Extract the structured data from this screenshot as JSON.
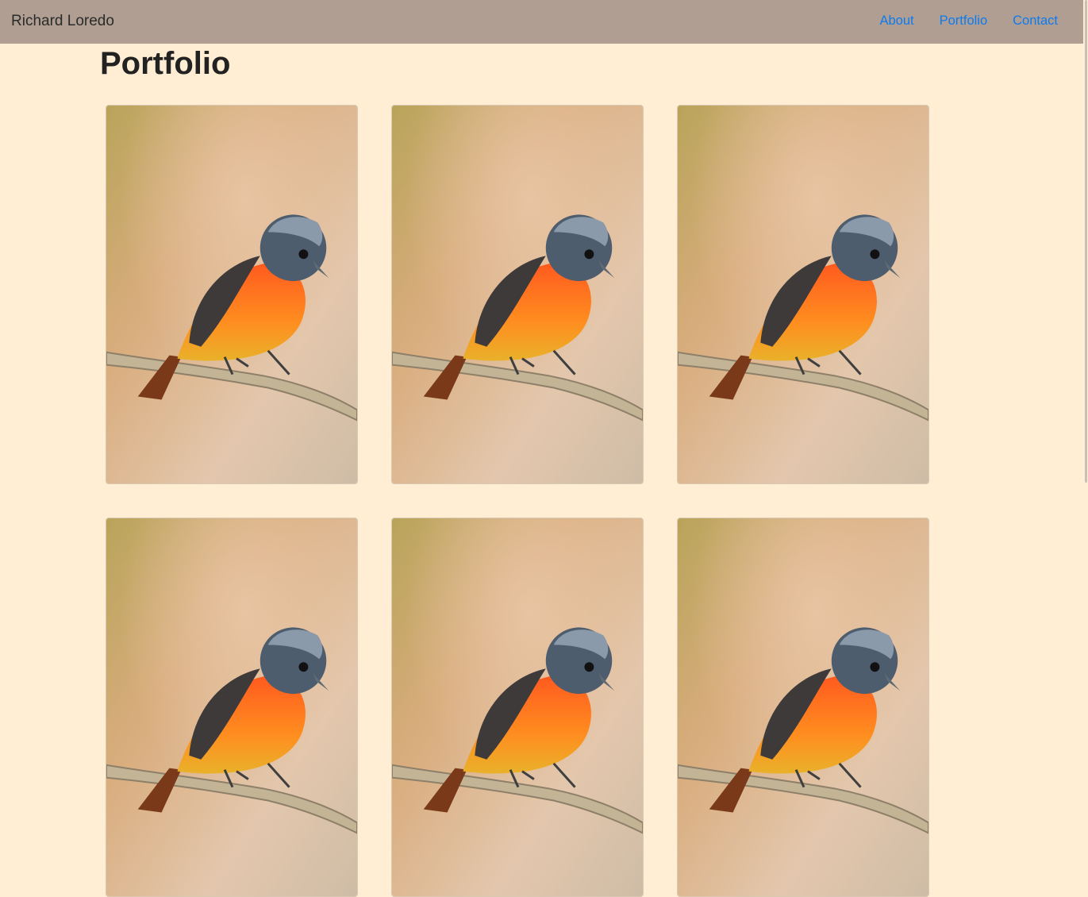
{
  "navbar": {
    "brand": "Richard Loredo",
    "links": [
      {
        "label": "About"
      },
      {
        "label": "Portfolio"
      },
      {
        "label": "Contact"
      }
    ]
  },
  "main": {
    "title": "Portfolio",
    "gallery": {
      "image_subject": "bird-on-branch",
      "count": 6
    }
  },
  "colors": {
    "page_background": "#ffeed3",
    "navbar_background": "#af9e91",
    "link": "#0d7bf0"
  }
}
